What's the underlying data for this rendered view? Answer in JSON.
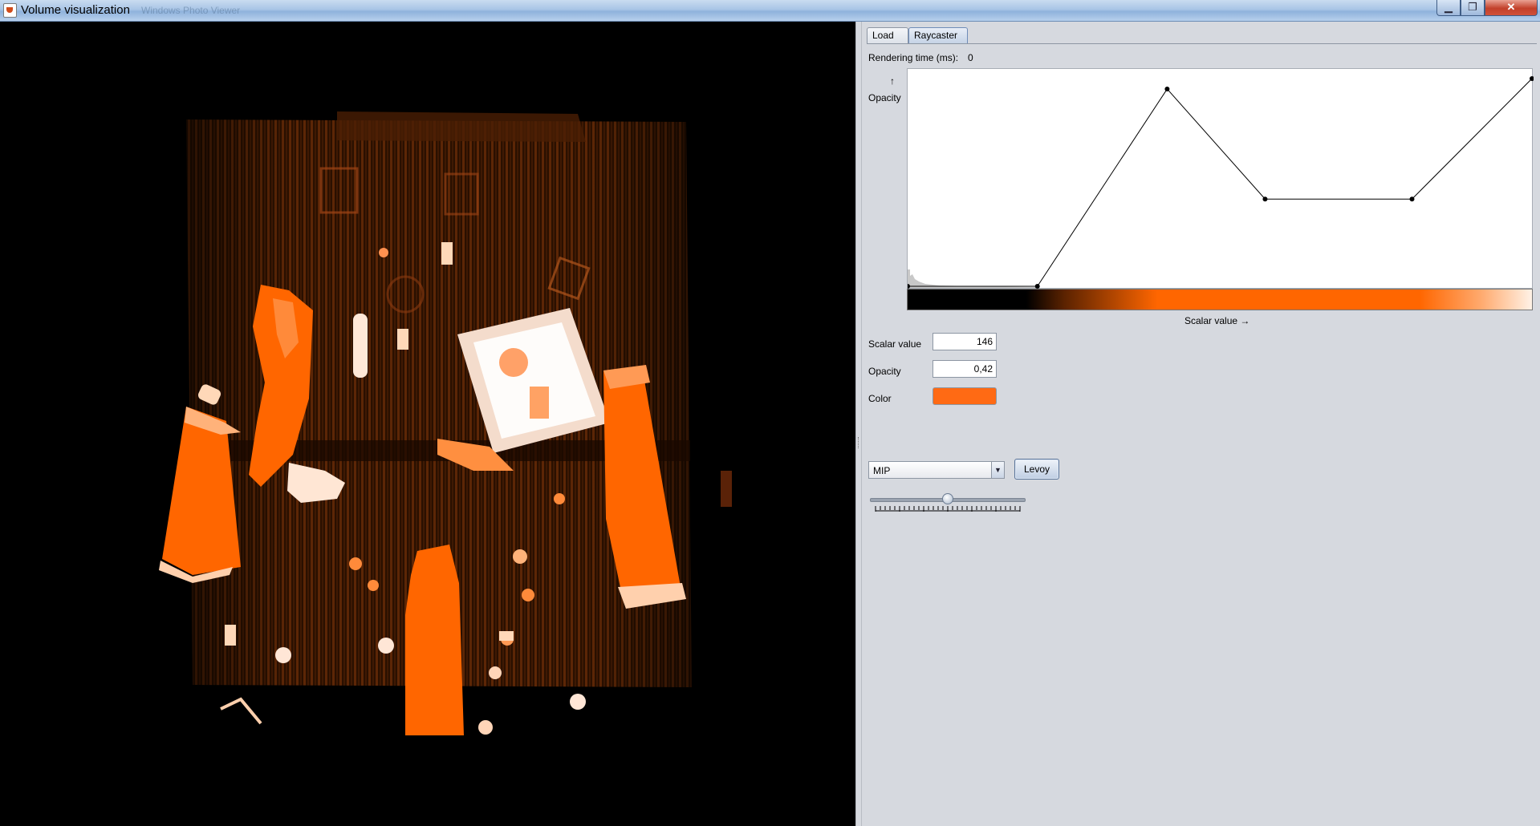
{
  "window": {
    "title": "Volume visualization",
    "background_title": "Windows Photo Viewer",
    "controls": {
      "minimize": "▁",
      "maximize": "❐",
      "close": "✕"
    }
  },
  "tabs": [
    {
      "label": "Load",
      "selected": false
    },
    {
      "label": "Raycaster",
      "selected": true
    }
  ],
  "render_info": {
    "label": "Rendering time (ms):",
    "value": "0"
  },
  "transfer_function": {
    "y_axis_arrow": "↑",
    "y_axis_label": "Opacity",
    "x_axis_label": "Scalar value →",
    "scalar_range": [
      0,
      255
    ],
    "opacity_range": [
      0,
      1
    ],
    "control_points": [
      {
        "scalar": 0,
        "opacity": 0.0
      },
      {
        "scalar": 53,
        "opacity": 0.0
      },
      {
        "scalar": 106,
        "opacity": 0.95
      },
      {
        "scalar": 146,
        "opacity": 0.42
      },
      {
        "scalar": 206,
        "opacity": 0.42
      },
      {
        "scalar": 255,
        "opacity": 1.0
      }
    ],
    "colorbar_colors": [
      "#000000",
      "#ff6600",
      "#ffffff"
    ]
  },
  "point_editor": {
    "scalar_label": "Scalar value",
    "scalar_value": "146",
    "opacity_label": "Opacity",
    "opacity_value": "0,42",
    "color_label": "Color",
    "color_value": "#ff6a14"
  },
  "render_controls": {
    "mode_selected": "MIP",
    "levoy_button": "Levoy",
    "slider_level": 0.5
  },
  "icons": {
    "app": "java-cup-icon",
    "dropdown": "triangle-down-icon"
  },
  "colors": {
    "accent": "#ff6600",
    "viewport_background": "#000000",
    "panel_background": "#d6d9df"
  }
}
